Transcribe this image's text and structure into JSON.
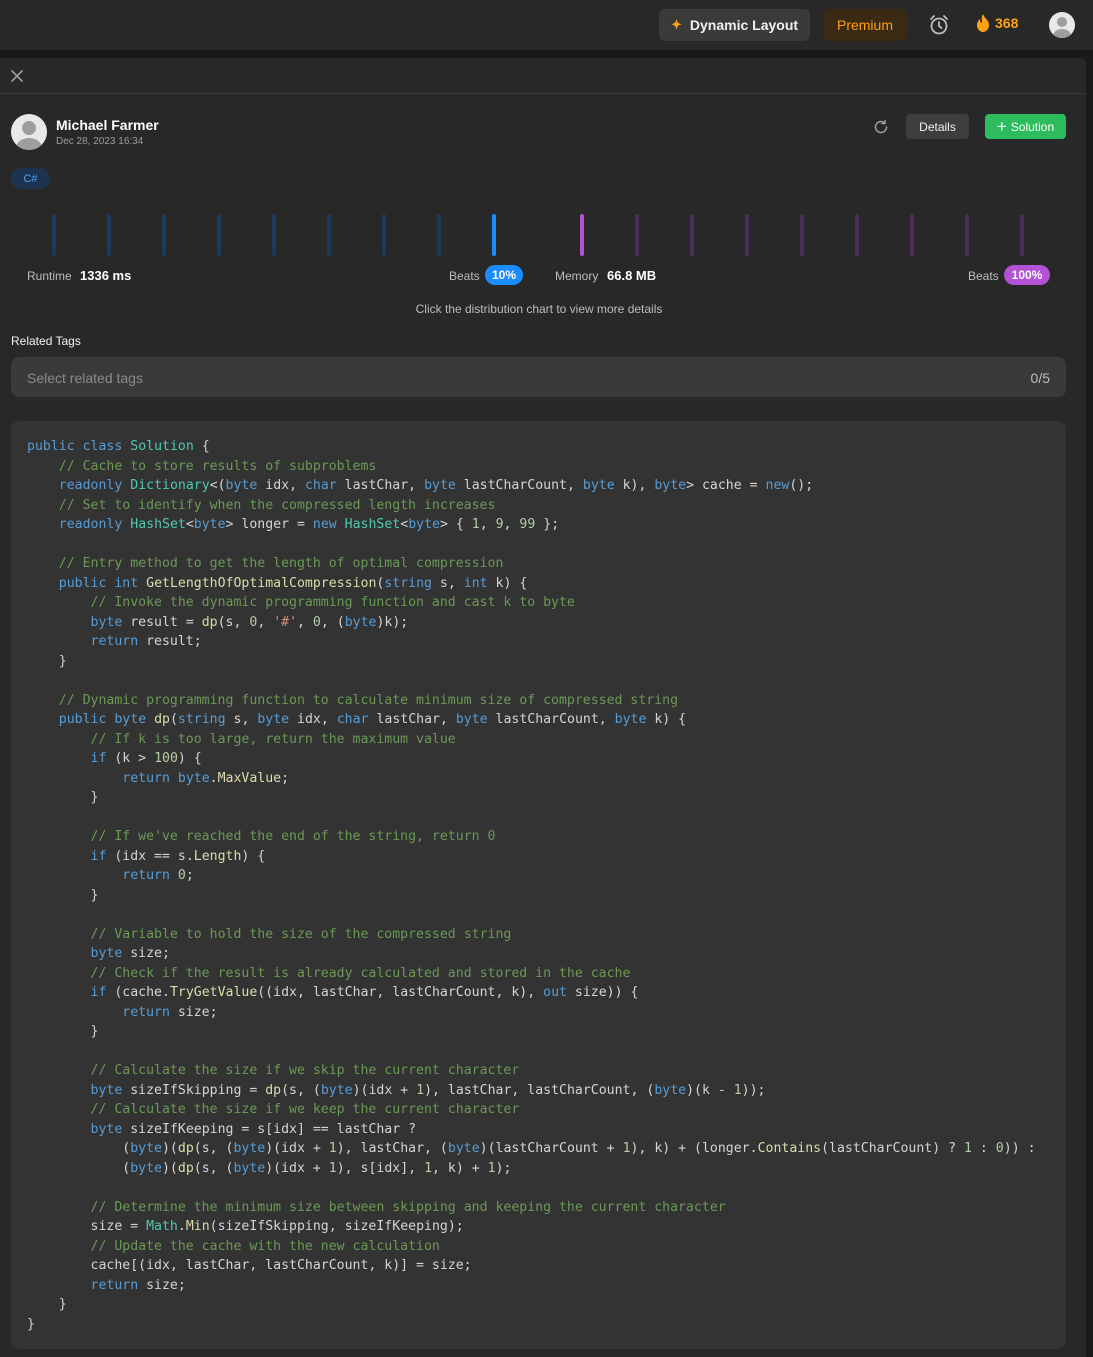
{
  "topbar": {
    "dynamic_layout_label": "Dynamic Layout",
    "premium_label": "Premium",
    "streak_count": "368"
  },
  "submission": {
    "author": "Michael Farmer",
    "date": "Dec 28, 2023 16:34",
    "details_label": "Details",
    "solution_label": "Solution",
    "language": "C#"
  },
  "stats": {
    "runtime_label": "Runtime",
    "runtime_value": "1336 ms",
    "runtime_beats_label": "Beats",
    "runtime_beats": "10%",
    "memory_label": "Memory",
    "memory_value": "66.8 MB",
    "memory_beats_label": "Beats",
    "memory_beats": "100%",
    "hint": "Click the distribution chart to view more details",
    "colors": {
      "runtime": "#1a8cff",
      "memory": "#b452d6"
    }
  },
  "related_tags": {
    "label": "Related Tags",
    "placeholder": "Select related tags",
    "count": "0/5"
  },
  "code": "public class Solution {\n    // Cache to store results of subproblems\n    readonly Dictionary<(byte idx, char lastChar, byte lastCharCount, byte k), byte> cache = new();\n    // Set to identify when the compressed length increases\n    readonly HashSet<byte> longer = new HashSet<byte> { 1, 9, 99 };\n\n    // Entry method to get the length of optimal compression\n    public int GetLengthOfOptimalCompression(string s, int k) {\n        // Invoke the dynamic programming function and cast k to byte\n        byte result = dp(s, 0, '#', 0, (byte)k);\n        return result;\n    }\n\n    // Dynamic programming function to calculate minimum size of compressed string\n    public byte dp(string s, byte idx, char lastChar, byte lastCharCount, byte k) {\n        // If k is too large, return the maximum value\n        if (k > 100) {\n            return byte.MaxValue;\n        }\n\n        // If we've reached the end of the string, return 0\n        if (idx == s.Length) {\n            return 0;\n        }\n\n        // Variable to hold the size of the compressed string\n        byte size;\n        // Check if the result is already calculated and stored in the cache\n        if (cache.TryGetValue((idx, lastChar, lastCharCount, k), out size)) {\n            return size;\n        }\n\n        // Calculate the size if we skip the current character\n        byte sizeIfSkipping = dp(s, (byte)(idx + 1), lastChar, lastCharCount, (byte)(k - 1));\n        // Calculate the size if we keep the current character\n        byte sizeIfKeeping = s[idx] == lastChar ?\n            (byte)(dp(s, (byte)(idx + 1), lastChar, (byte)(lastCharCount + 1), k) + (longer.Contains(lastCharCount) ? 1 : 0)) :\n            (byte)(dp(s, (byte)(idx + 1), s[idx], 1, k) + 1);\n\n        // Determine the minimum size between skipping and keeping the current character\n        size = Math.Min(sizeIfSkipping, sizeIfKeeping);\n        // Update the cache with the new calculation\n        cache[(idx, lastChar, lastCharCount, k)] = size;\n        return size;\n    }\n}"
}
